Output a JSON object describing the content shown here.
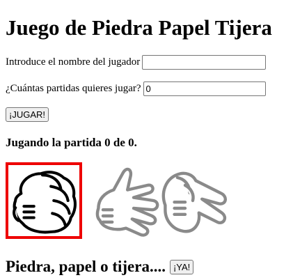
{
  "title": "Juego de Piedra Papel Tijera",
  "player_name": {
    "label": "Introduce el nombre del jugador",
    "value": "",
    "placeholder": ""
  },
  "rounds": {
    "label": "¿Cuántas partidas quieres jugar?",
    "value": "0"
  },
  "play_button": "¡JUGAR!",
  "status": "Jugando la partida 0 de 0.",
  "choices": [
    {
      "name": "piedra",
      "icon": "rock-hand-icon",
      "selected": true
    },
    {
      "name": "papel",
      "icon": "paper-hand-icon",
      "selected": false
    },
    {
      "name": "tijera",
      "icon": "scissors-hand-icon",
      "selected": false
    }
  ],
  "prompt": "Piedra, papel o tijera....",
  "go_button": "¡YA!",
  "colors": {
    "selected_border": "#ee0000",
    "inactive_hand": "#8a8a8a"
  }
}
